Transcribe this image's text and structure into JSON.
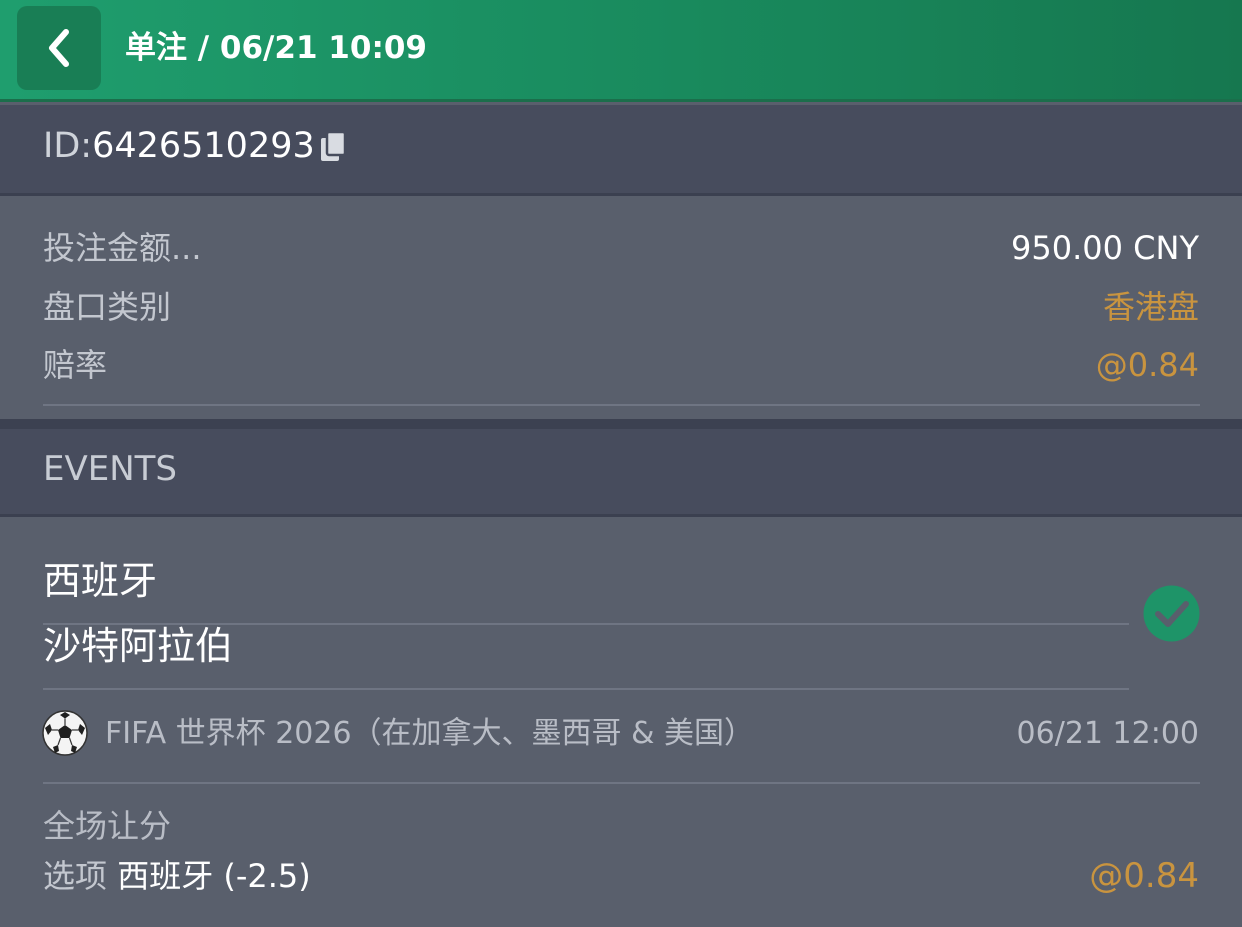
{
  "header": {
    "title": "单注 / 06/21 10:09",
    "background": "#1f9e6e"
  },
  "ticket": {
    "id_label": "ID:",
    "id_value": "6426510293"
  },
  "details": {
    "stake_label": "投注金额...",
    "stake_value": "950.00 CNY",
    "odds_type_label": "盘口类别",
    "odds_type_value": "香港盘",
    "odds_label": "赔率",
    "odds_value": "@0.84"
  },
  "events": {
    "section_label": "EVENTS",
    "home_team": "西班牙",
    "away_team": "沙特阿拉伯",
    "league": "FIFA 世界杯 2026（在加拿大、墨西哥 & 美国）",
    "kickoff": "06/21 12:00",
    "market": "全场让分",
    "selection_label": "选项",
    "selection_value": "西班牙 (-2.5)",
    "selection_odds": "@0.84",
    "status": "check-icon"
  },
  "colors": {
    "accent_gold": "#c9943f",
    "success_green": "#1e9468"
  }
}
